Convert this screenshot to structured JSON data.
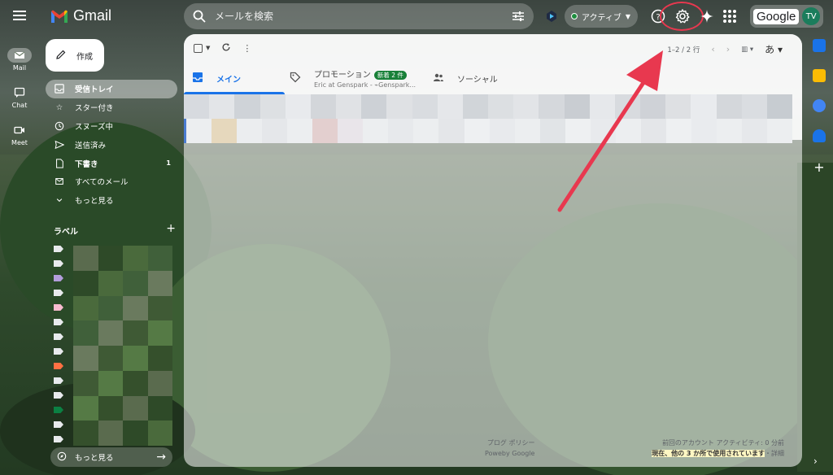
{
  "app": {
    "name": "Gmail",
    "search_placeholder": "メールを検索",
    "status_label": "アクティブ",
    "account_badge": "Google",
    "avatar_initials": "TV",
    "accent_color": "#1a73e8",
    "status_color": "#1e8e3e",
    "annotation_color": "#e8384f"
  },
  "rail": {
    "items": [
      {
        "label": "Mail",
        "icon": "mail-icon"
      },
      {
        "label": "Chat",
        "icon": "chat-icon"
      },
      {
        "label": "Meet",
        "icon": "video-icon"
      }
    ]
  },
  "sidebar": {
    "compose_label": "作成",
    "nav": [
      {
        "label": "受信トレイ",
        "icon": "inbox-icon",
        "count": ""
      },
      {
        "label": "スター付き",
        "icon": "star-icon",
        "count": ""
      },
      {
        "label": "スヌーズ中",
        "icon": "clock-icon",
        "count": ""
      },
      {
        "label": "送信済み",
        "icon": "send-icon",
        "count": ""
      },
      {
        "label": "下書き",
        "icon": "draft-icon",
        "count": "1"
      },
      {
        "label": "すべてのメール",
        "icon": "all-mail-icon",
        "count": ""
      },
      {
        "label": "もっと見る",
        "icon": "chevron-down-icon",
        "count": ""
      }
    ],
    "labels_heading": "ラベル",
    "labels_add": "+",
    "label_colors": [
      "#e8eaed",
      "#e8eaed",
      "#b39ddb",
      "#e8eaed",
      "#f8bbd0",
      "#e8eaed",
      "#e8eaed",
      "#e8eaed",
      "#ff7043",
      "#e8eaed",
      "#e8eaed",
      "#0b8043",
      "#e8eaed",
      "#e8eaed"
    ],
    "more_pill_label": "もっと見る"
  },
  "toolbar": {
    "pagination": "1–2 / 2 行",
    "lang_glyph": "あ"
  },
  "tabs": [
    {
      "label": "メイン",
      "sub": "",
      "badge": ""
    },
    {
      "label": "プロモーション",
      "sub": "Eric at Genspark - ⌁Genspark...",
      "badge": "新着 2 件"
    },
    {
      "label": "ソーシャル",
      "sub": "",
      "badge": ""
    }
  ],
  "footer": {
    "left_line1": "プログ ポリシー",
    "left_line2": "Poweby Google",
    "right_line1": "前回のアカウント アクティビティ: 0 分前",
    "right_line2_highlight": "現在、他の 3 か所で使用されています",
    "right_line2_suffix": "・詳細"
  },
  "side_panel": {
    "icons": [
      {
        "name": "calendar-icon",
        "color": "#1a73e8"
      },
      {
        "name": "keep-icon",
        "color": "#fbbc04"
      },
      {
        "name": "tasks-icon",
        "color": "#4285f4"
      },
      {
        "name": "contacts-icon",
        "color": "#1a73e8"
      }
    ],
    "add_label": "+",
    "expand_label": "›"
  }
}
